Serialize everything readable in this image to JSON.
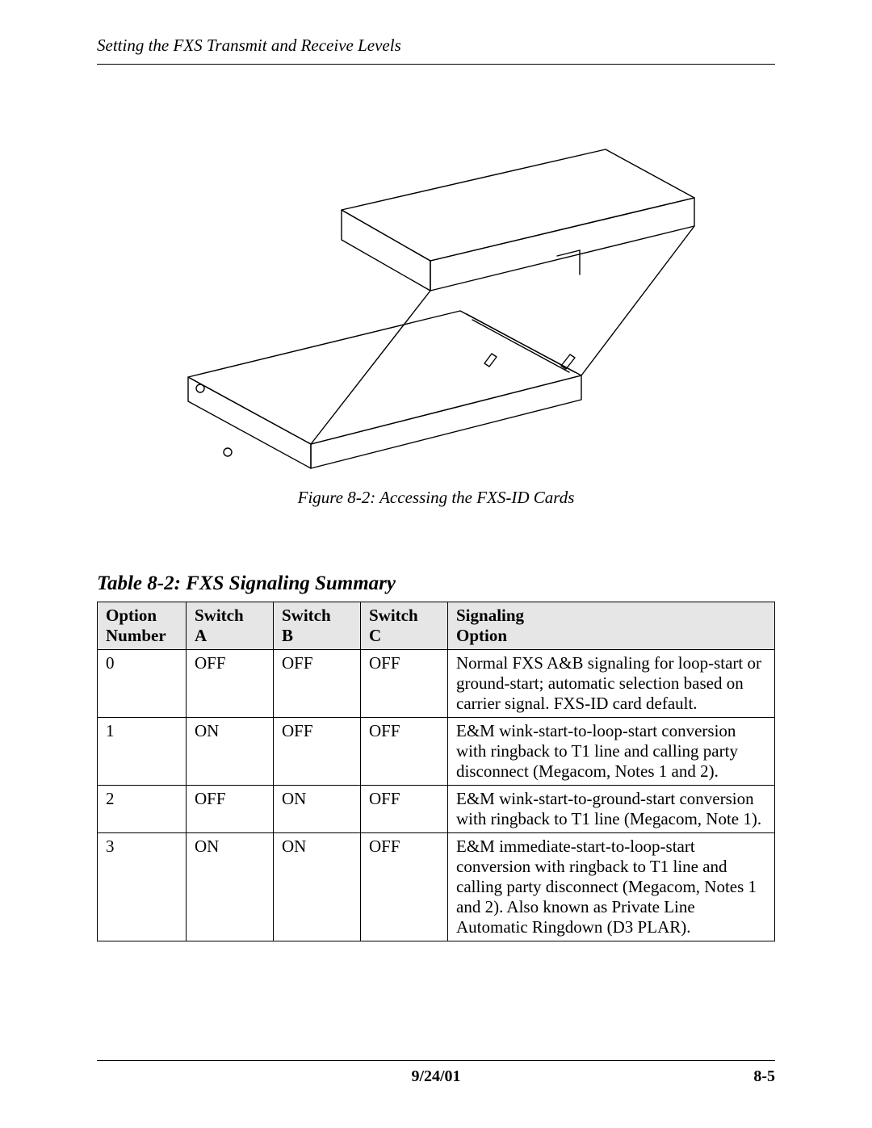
{
  "header": {
    "running_title": "Setting the FXS Transmit and Receive Levels"
  },
  "figure": {
    "caption": "Figure 8-2: Accessing the FXS-ID Cards"
  },
  "table": {
    "title": "Table 8-2: FXS Signaling Summary",
    "headers": {
      "option_number_l1": "Option",
      "option_number_l2": "Number",
      "switch_a_l1": "Switch",
      "switch_a_l2": "A",
      "switch_b_l1": "Switch",
      "switch_b_l2": "B",
      "switch_c_l1": "Switch",
      "switch_c_l2": "C",
      "signaling_l1": "Signaling",
      "signaling_l2": "Option"
    },
    "rows": [
      {
        "num": "0",
        "a": "OFF",
        "b": "OFF",
        "c": "OFF",
        "sig": "Normal FXS A&B signaling for loop-start or ground-start; automatic selection based on carrier signal. FXS-ID card default."
      },
      {
        "num": "1",
        "a": "ON",
        "b": "OFF",
        "c": "OFF",
        "sig": "E&M wink-start-to-loop-start conversion with ringback to T1 line and calling party disconnect (Megacom, Notes 1 and 2)."
      },
      {
        "num": "2",
        "a": "OFF",
        "b": "ON",
        "c": "OFF",
        "sig": "E&M wink-start-to-ground-start conversion with ringback to T1 line (Megacom, Note 1)."
      },
      {
        "num": "3",
        "a": "ON",
        "b": "ON",
        "c": "OFF",
        "sig": "E&M immediate-start-to-loop-start conversion with ringback to T1 line and calling party disconnect (Megacom, Notes 1 and 2). Also known as Private Line Automatic Ringdown (D3 PLAR)."
      }
    ]
  },
  "footer": {
    "date": "9/24/01",
    "page": "8-5"
  }
}
